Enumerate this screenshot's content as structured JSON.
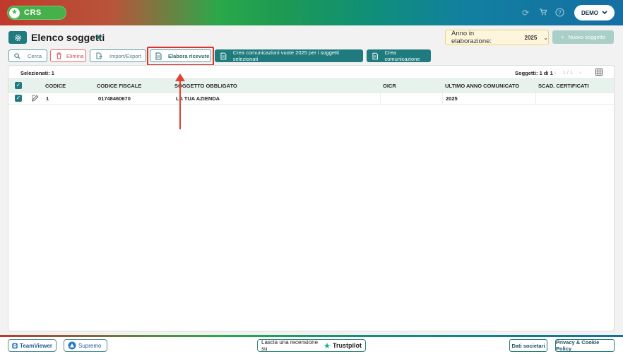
{
  "header": {
    "logo_text": "CRS",
    "user_menu": "DEMO"
  },
  "page": {
    "title": "Elenco soggetti",
    "year_label": "Anno in elaborazione:",
    "year_value": "2025",
    "new_button": "Nuovo soggetto"
  },
  "toolbar": {
    "search": "Cerca",
    "delete": "Elimina",
    "import_export": "Import/Export",
    "process_receipts": "Elabora ricevute",
    "create_empty": "Crea comunicazioni vuote 2025 per i soggetti selezionati",
    "create_comm": "Crea comunicazione"
  },
  "table": {
    "selected": "Selezionati: 1",
    "count": "Soggetti: 1 di 1",
    "page": "1 / 1",
    "columns": [
      "CODICE",
      "CODICE FISCALE",
      "SOGGETTO OBBLIGATO",
      "OICR",
      "ULTIMO ANNO COMUNICATO",
      "SCAD. CERTIFICATI"
    ],
    "rows": [
      {
        "codice": "1",
        "codice_fiscale": "01748460670",
        "soggetto": "LA TUA AZIENDA",
        "oicr": "",
        "ultimo_anno": "2025",
        "scad": ""
      }
    ]
  },
  "footer": {
    "teamviewer": "TeamViewer",
    "supremo": "Supremo",
    "review_prefix": "Lascia una recensione su",
    "trustpilot": "Trustpilot",
    "company_data": "Dati societari",
    "privacy": "Privacy & Cookie Policy"
  },
  "colors": {
    "primary": "#1f7b7d",
    "danger": "#d25252",
    "highlight": "#d9332a"
  }
}
